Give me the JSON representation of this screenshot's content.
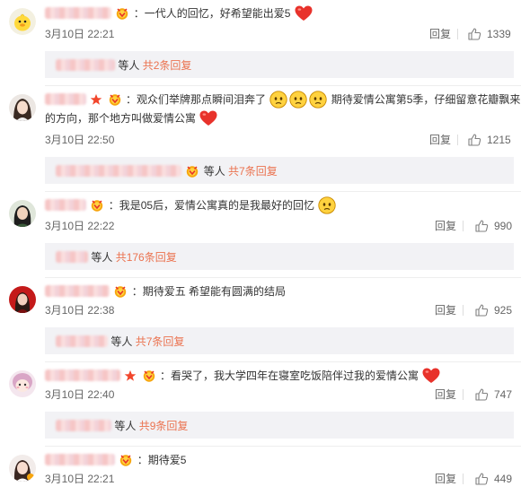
{
  "comments": [
    {
      "text": "：一代人的回忆，好希望能出爱5",
      "time": "3月10日 22:21",
      "reply_label": "回复",
      "likes": "1339",
      "sub_suffix": "等人",
      "sub_count": "共2条回复"
    },
    {
      "text1": "：观众们举牌那点瞬间泪奔了",
      "text2": "期待爱情公寓第5季，仔细留意花瓣飘来",
      "text3": "的方向，那个地方叫做爱情公寓",
      "time": "3月10日 22:50",
      "reply_label": "回复",
      "likes": "1215",
      "sub_suffix": "等人",
      "sub_count": "共7条回复"
    },
    {
      "text": "：我是05后，爱情公寓真的是我最好的回忆",
      "time": "3月10日 22:22",
      "reply_label": "回复",
      "likes": "990",
      "sub_suffix": "等人",
      "sub_count": "共176条回复"
    },
    {
      "text": "：期待爱五  希望能有圆满的结局",
      "time": "3月10日 22:38",
      "reply_label": "回复",
      "likes": "925",
      "sub_suffix": "等人",
      "sub_count": "共7条回复"
    },
    {
      "text": "：看哭了，我大学四年在寝室吃饭陪伴过我的爱情公寓",
      "time": "3月10日 22:40",
      "reply_label": "回复",
      "likes": "747",
      "sub_suffix": "等人",
      "sub_count": "共9条回复"
    },
    {
      "text": "：期待爱5",
      "time": "3月10日 22:21",
      "reply_label": "回复",
      "likes": "449"
    }
  ],
  "colors": {
    "accent": "#eb7350",
    "heart": "#e8322b",
    "star": "#f2462c",
    "sub_bg": "#f2f2f5"
  },
  "icons": [
    "duck-avatar",
    "vip-badge",
    "heart-emoji",
    "sad-face-emoji",
    "star-icon",
    "thumbs-up-icon"
  ]
}
